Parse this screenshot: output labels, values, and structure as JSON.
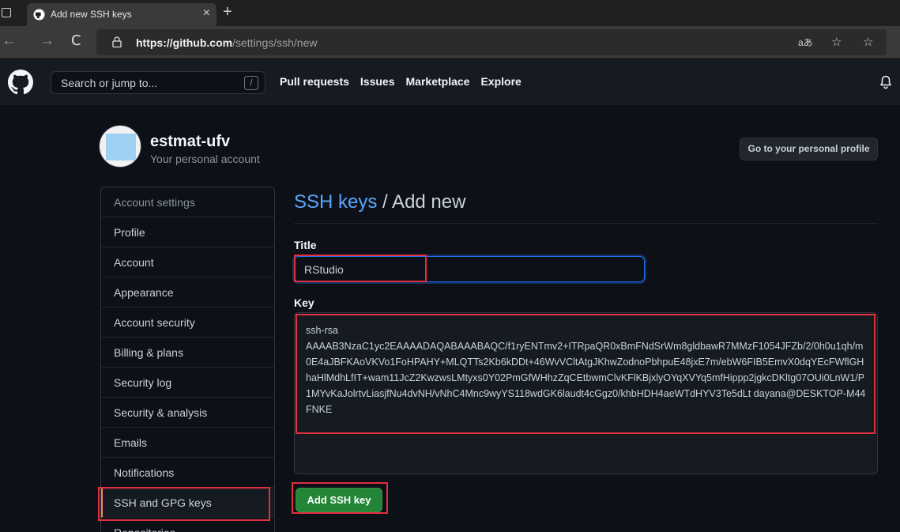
{
  "browser": {
    "tab_title": "Add new SSH keys",
    "tab_close": "×",
    "new_tab": "+",
    "url_host": "https://github.com",
    "url_path": "/settings/ssh/new",
    "back_icon": "←",
    "forward_icon": "→",
    "refresh_icon": "C",
    "read_aloud_label": "aあ",
    "favorites_add_icon": "☆",
    "favorites_icon": "☆"
  },
  "header": {
    "search_placeholder": "Search or jump to...",
    "search_shortcut": "/",
    "nav": [
      "Pull requests",
      "Issues",
      "Marketplace",
      "Explore"
    ]
  },
  "profile": {
    "username": "estmat-ufv",
    "subtitle": "Your personal account",
    "profile_button": "Go to your personal profile"
  },
  "sidebar": {
    "items": [
      {
        "label": "Account settings",
        "heading": true
      },
      {
        "label": "Profile"
      },
      {
        "label": "Account"
      },
      {
        "label": "Appearance"
      },
      {
        "label": "Account security"
      },
      {
        "label": "Billing & plans"
      },
      {
        "label": "Security log"
      },
      {
        "label": "Security & analysis"
      },
      {
        "label": "Emails"
      },
      {
        "label": "Notifications"
      },
      {
        "label": "SSH and GPG keys",
        "selected": true
      },
      {
        "label": "Repositories"
      }
    ]
  },
  "main": {
    "breadcrumb_link": "SSH keys",
    "breadcrumb_rest": " / Add new",
    "title_label": "Title",
    "title_value": "RStudio",
    "key_label": "Key",
    "key_value": "ssh-rsa\nAAAAB3NzaC1yc2EAAAADAQABAAABAQC/f1ryENTmv2+ITRpaQR0xBmFNdSrWm8gldbawR7MMzF1054JFZb/2/0h0u1qh/m0E4aJBFKAoVKVo1FoHPAHY+MLQTTs2Kb6kDDt+46WvVCltAtgJKhwZodnoPbhpuE48jxE7m/ebW6FIB5EmvX0dqYEcFWflGHhaHlMdhLfIT+wam11JcZ2KwzwsLMtyxs0Y02PmGfWHhzZqCEtbwmClvKFlKBjxlyOYqXVYq5mfHippp2jgkcDKltg07OUi0LnW1/P1MYvKaJolrtvLiasjfNu4dvNH/vNhC4Mnc9wyYS118wdGK6laudt4cGgz0/khbHDH4aeWTdHYV3Te5dLt dayana@DESKTOP-M44FNKE",
    "add_button": "Add SSH key"
  }
}
